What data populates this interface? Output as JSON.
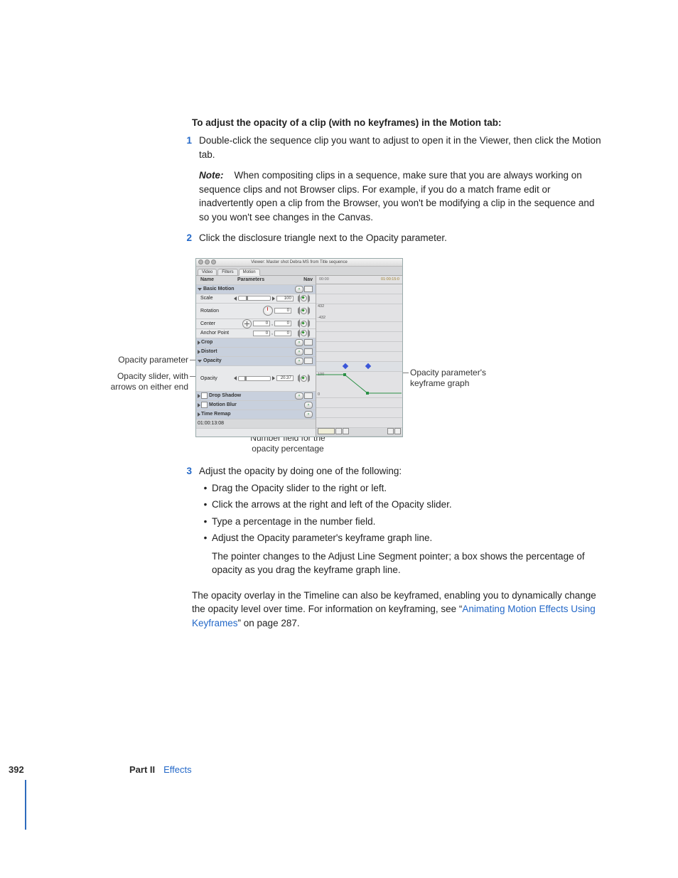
{
  "heading": "To adjust the opacity of a clip (with no keyframes) in the Motion tab:",
  "steps": {
    "s1": {
      "num": "1",
      "body": "Double-click the sequence clip you want to adjust to open it in the Viewer, then click the Motion tab.",
      "note_label": "Note:",
      "note_body": "When compositing clips in a sequence, make sure that you are always working on sequence clips and not Browser clips. For example, if you do a match frame edit or inadvertently open a clip from the Browser, you won't be modifying a clip in the sequence and so you won't see changes in the Canvas."
    },
    "s2": {
      "num": "2",
      "body": "Click the disclosure triangle next to the Opacity parameter."
    },
    "s3": {
      "num": "3",
      "body": "Adjust the opacity by doing one of the following:",
      "bullets": {
        "b1": "Drag the Opacity slider to the right or left.",
        "b2": "Click the arrows at the right and left of the Opacity slider.",
        "b3": "Type a percentage in the number field.",
        "b4": "Adjust the Opacity parameter's keyframe graph line.",
        "b4_follow": "The pointer changes to the Adjust Line Segment pointer; a box shows the percentage of opacity as you drag the keyframe graph line."
      }
    }
  },
  "closing": {
    "text_a": "The opacity overlay in the Timeline can also be keyframed, enabling you to dynamically change the opacity level over time. For information on keyframing, see “",
    "link": "Animating Motion Effects Using Keyframes",
    "text_b": "” on page 287."
  },
  "callouts": {
    "c1": "Opacity parameter",
    "c2a": "Opacity slider, with",
    "c2b": "arrows on either end",
    "c3a": "Opacity parameter's",
    "c3b": "keyframe graph",
    "c4a": "Number field for the",
    "c4b": "opacity percentage"
  },
  "fcp": {
    "title": "Viewer: Master shot Debra MS from Title sequence",
    "tabs": {
      "video": "Video",
      "filters": "Filters",
      "motion": "Motion"
    },
    "cols": {
      "name": "Name",
      "parameters": "Parameters",
      "nav": "Nav"
    },
    "rows": {
      "basic": "Basic Motion",
      "scale": "Scale",
      "scale_val": "100",
      "rotation": "Rotation",
      "rotation_val": "0",
      "rot_top": "432",
      "rot_bot": "-432",
      "center": "Center",
      "center_x": "0",
      "center_y": "0",
      "anchor": "Anchor Point",
      "anchor_x": "0",
      "anchor_y": "0",
      "crop": "Crop",
      "distort": "Distort",
      "opacity": "Opacity",
      "opacity_param": "Opacity",
      "opacity_val": "20.37",
      "drop": "Drop Shadow",
      "blur": "Motion Blur",
      "remap": "Time Remap",
      "timecode": "01:00:13:08",
      "ruler_a": "00:00",
      "ruler_b": "01:00:15:0",
      "graph_top": "100",
      "graph_bot": "0"
    }
  },
  "footer": {
    "page": "392",
    "part": "Part II",
    "section": "Effects"
  }
}
